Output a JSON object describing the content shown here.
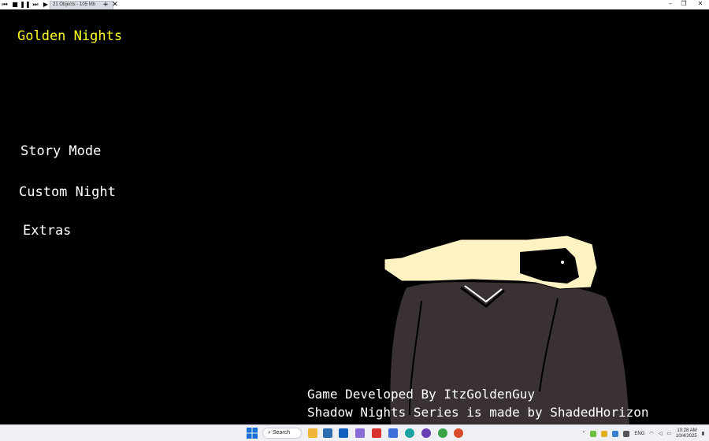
{
  "app": {
    "tab_label": "21 Objects - 105 Mb",
    "toolbar_icons": [
      "skip-start-icon",
      "stop-icon",
      "pause-icon",
      "step-forward-icon",
      "play-icon"
    ]
  },
  "game": {
    "title": "Golden Nights",
    "title_color": "#ffff20",
    "menu": {
      "story_mode": "Story Mode",
      "custom_night": "Custom Night",
      "extras": "Extras"
    },
    "credits": {
      "line1": "Game Developed By ItzGoldenGuy",
      "line2": "Shadow Nights Series is made by ShadedHorizon"
    }
  },
  "taskbar": {
    "search_label": "Search",
    "language": "ENG",
    "time": "10:28 AM",
    "date": "10/4/2025"
  }
}
